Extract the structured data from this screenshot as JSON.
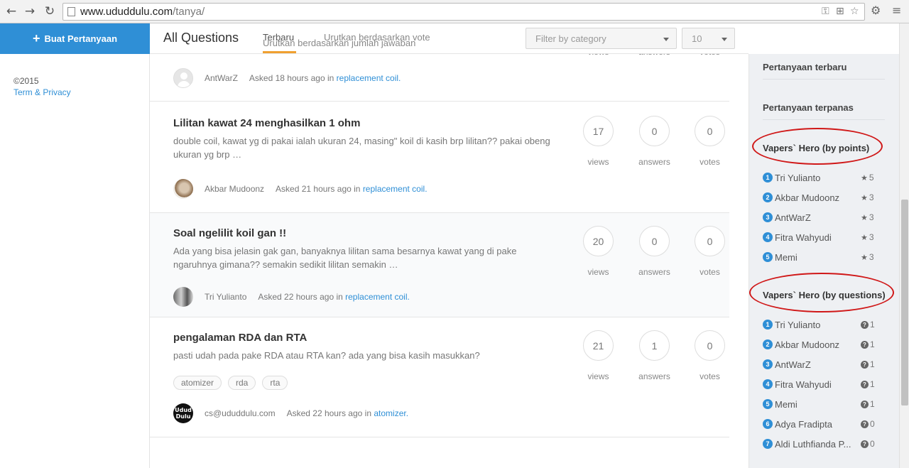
{
  "browser": {
    "url_host": "www.ududdulu.com",
    "url_path": "/tanya/"
  },
  "left_sidebar": {
    "ask_button": "Buat Pertanyaan",
    "copyright": "©2015",
    "terms_link": "Term & Privacy"
  },
  "header": {
    "title": "All Questions",
    "tabs": [
      {
        "label": "Terbaru"
      },
      {
        "label": "Urutkan berdasarkan vote"
      }
    ],
    "dropdown_option": "Urutkan berdasarkan jumlah jawaban",
    "category_placeholder": "Filter by category",
    "per_page": "10"
  },
  "questions": [
    {
      "author": "AntWarZ",
      "asked": "Asked 18 hours ago in",
      "category": "replacement coil.",
      "views_label": "views",
      "answers_label": "answers",
      "votes_label": "votes"
    },
    {
      "title": "Lilitan kawat 24 menghasilkan 1 ohm",
      "excerpt": "double coil, kawat yg di pakai ialah ukuran 24, masing\" koil di kasih brp lilitan?? pakai obeng ukuran yg brp …",
      "author": "Akbar Mudoonz",
      "asked": "Asked 21 hours ago in",
      "category": "replacement coil.",
      "views": "17",
      "answers": "0",
      "votes": "0",
      "views_label": "views",
      "answers_label": "answers",
      "votes_label": "votes"
    },
    {
      "title": "Soal ngelilit koil gan !!",
      "excerpt": "Ada yang bisa jelasin gak gan, banyaknya lilitan sama besarnya kawat yang di pake ngaruhnya gimana?? semakin sedikit lilitan semakin …",
      "author": "Tri Yulianto",
      "asked": "Asked 22 hours ago in",
      "category": "replacement coil.",
      "views": "20",
      "answers": "0",
      "votes": "0",
      "views_label": "views",
      "answers_label": "answers",
      "votes_label": "votes"
    },
    {
      "title": "pengalaman RDA dan RTA",
      "excerpt": "pasti udah pada pake RDA atau RTA kan? ada yang bisa kasih masukkan?",
      "tags": [
        "atomizer",
        "rda",
        "rta"
      ],
      "author": "cs@ududdulu.com",
      "avatar_text": "Udud Dulu",
      "asked": "Asked 22 hours ago in",
      "category": "atomizer.",
      "views": "21",
      "answers": "1",
      "votes": "0",
      "views_label": "views",
      "answers_label": "answers",
      "votes_label": "votes"
    }
  ],
  "right_sidebar": {
    "latest_link": "Pertanyaan terbaru",
    "hottest_link": "Pertanyaan terpanas",
    "by_points": {
      "heading": "Vapers` Hero (by points)",
      "rows": [
        {
          "rank": "1",
          "name": "Tri Yulianto",
          "score": "5"
        },
        {
          "rank": "2",
          "name": "Akbar Mudoonz",
          "score": "3"
        },
        {
          "rank": "3",
          "name": "AntWarZ",
          "score": "3"
        },
        {
          "rank": "4",
          "name": "Fitra Wahyudi",
          "score": "3"
        },
        {
          "rank": "5",
          "name": "Memi",
          "score": "3"
        }
      ]
    },
    "by_questions": {
      "heading": "Vapers` Hero (by questions)",
      "rows": [
        {
          "rank": "1",
          "name": "Tri Yulianto",
          "score": "1"
        },
        {
          "rank": "2",
          "name": "Akbar Mudoonz",
          "score": "1"
        },
        {
          "rank": "3",
          "name": "AntWarZ",
          "score": "1"
        },
        {
          "rank": "4",
          "name": "Fitra Wahyudi",
          "score": "1"
        },
        {
          "rank": "5",
          "name": "Memi",
          "score": "1"
        },
        {
          "rank": "6",
          "name": "Adya Fradipta",
          "score": "0"
        },
        {
          "rank": "7",
          "name": "Aldi Luthfianda P...",
          "score": "0"
        }
      ]
    },
    "annotation_color": "#d01818"
  },
  "colors": {
    "accent": "#2f8fd6",
    "tab_underline": "#f0a030"
  },
  "icons": {
    "star": "★",
    "question": "?"
  }
}
